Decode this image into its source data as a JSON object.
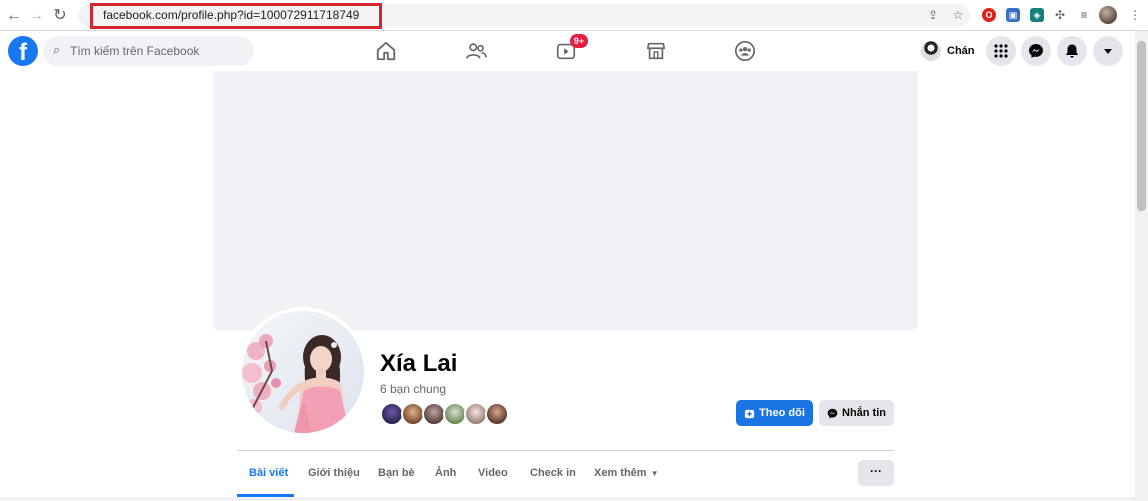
{
  "browser": {
    "url": "facebook.com/profile.php?id=100072911718749",
    "back_icon": "arrow-left-icon",
    "forward_icon": "arrow-right-icon",
    "reload_icon": "reload-icon"
  },
  "header": {
    "logo": "f",
    "search_placeholder": "Tìm kiếm trên Facebook",
    "video_badge": "9+",
    "profile_name": "Chán"
  },
  "profile": {
    "name": "Xía Lai",
    "mutual_friends": "6 bạn chung",
    "follow_label": "Theo dõi",
    "message_label": "Nhắn tin"
  },
  "tabs": [
    {
      "label": "Bài viết"
    },
    {
      "label": "Giới thiệu"
    },
    {
      "label": "Bạn bè"
    },
    {
      "label": "Ảnh"
    },
    {
      "label": "Video"
    },
    {
      "label": "Check in"
    },
    {
      "label": "Xem thêm"
    }
  ],
  "more_label": "···",
  "colors": {
    "accent": "#1877f2",
    "badge": "#e41e3f",
    "highlight": "#d3262e"
  }
}
